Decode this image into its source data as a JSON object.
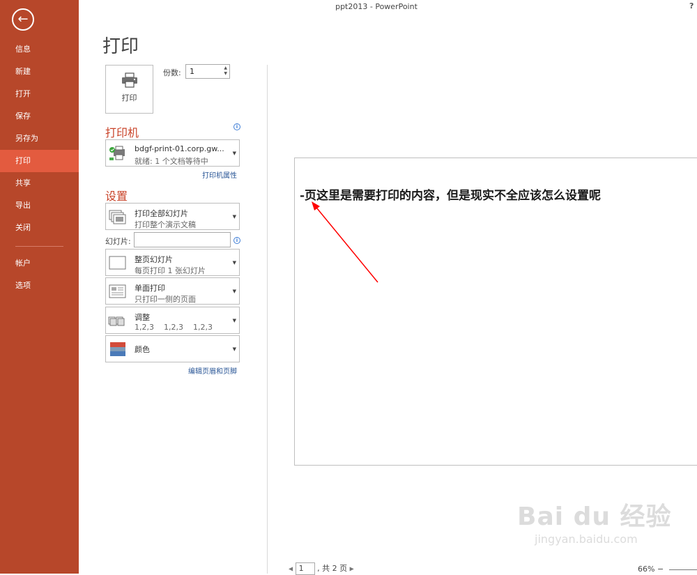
{
  "window": {
    "title": "ppt2013 - PowerPoint",
    "help": "?"
  },
  "nav": {
    "back_icon": "←",
    "items": [
      {
        "label": "信息"
      },
      {
        "label": "新建"
      },
      {
        "label": "打开"
      },
      {
        "label": "保存"
      },
      {
        "label": "另存为"
      },
      {
        "label": "打印"
      },
      {
        "label": "共享"
      },
      {
        "label": "导出"
      },
      {
        "label": "关闭"
      },
      {
        "label": "帐户"
      },
      {
        "label": "选项"
      }
    ],
    "active": "打印"
  },
  "page_title": "打印",
  "print_button": {
    "label": "打印",
    "icon": "printer-icon"
  },
  "copies": {
    "label": "份数:",
    "value": "1"
  },
  "printer": {
    "section_title": "打印机",
    "name": "bdgf-print-01.corp.gw...",
    "status": "就绪: 1 个文档等待中",
    "properties_link": "打印机属性",
    "info_icon": "i"
  },
  "settings": {
    "section_title": "设置",
    "range": {
      "title": "打印全部幻灯片",
      "sub": "打印整个演示文稿"
    },
    "slides_label": "幻灯片:",
    "slides_value": "",
    "layout": {
      "title": "整页幻灯片",
      "sub": "每页打印 1 张幻灯片"
    },
    "sides": {
      "title": "单面打印",
      "sub": "只打印一侧的页面"
    },
    "collate": {
      "title": "调整",
      "sub": "1,2,3    1,2,3    1,2,3"
    },
    "color": {
      "title": "颜色"
    },
    "header_footer_link": "编辑页眉和页脚"
  },
  "preview": {
    "slide_text": "-页这里是需要打印的内容，但是现实不全应该怎么设置呢",
    "arrow_color": "#ff0000"
  },
  "pager": {
    "current": "1",
    "total_text": ", 共 2 页"
  },
  "zoom": {
    "value": "66%",
    "minus": "−"
  },
  "watermark": {
    "logo": "Bai du 经验",
    "url": "jingyan.baidu.com"
  },
  "colors": {
    "accent": "#b7472a",
    "active_nav": "#e35b3f",
    "section_title": "#c9442a",
    "link": "#2b5797"
  }
}
